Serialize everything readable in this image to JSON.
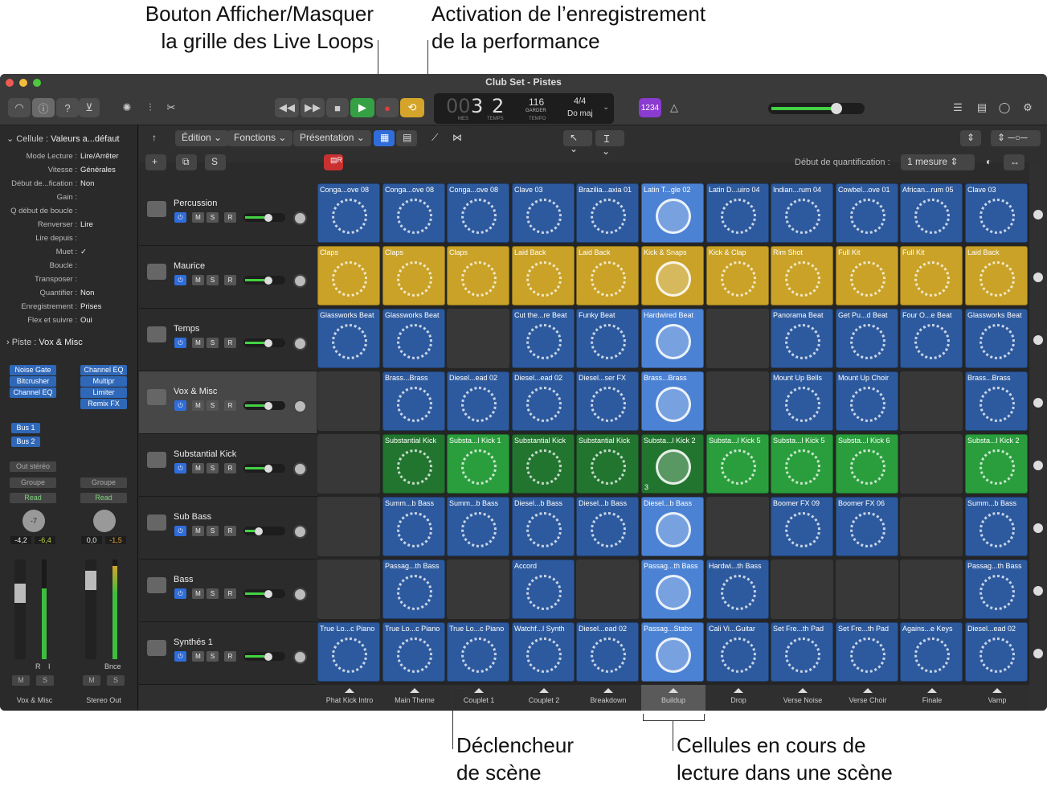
{
  "annotations": {
    "show_hide_grid_1": "Bouton Afficher/Masquer",
    "show_hide_grid_2": "la grille des Live Loops",
    "perf_record_1": "Activation de l’enregistrement",
    "perf_record_2": "de la performance",
    "scene_trigger_1": "Déclencheur",
    "scene_trigger_2": "de scène",
    "playing_cells_1": "Cellules en cours de",
    "playing_cells_2": "lecture dans une scène"
  },
  "window": {
    "title": "Club Set - Pistes"
  },
  "lcd": {
    "bars": "3",
    "beat_prefix": "00",
    "beats": "2",
    "tempo": "116",
    "tempo_mode": "GARDER",
    "signature": "4/4",
    "key": "Do maj",
    "label_bars": "MES",
    "label_beats": "TEMPS",
    "label_tempo": "TEMPO"
  },
  "count_in": "1234",
  "menus": {
    "edit": "Édition",
    "functions": "Fonctions",
    "view": "Présentation"
  },
  "quantize": {
    "label": "Début de quantification :",
    "value": "1 mesure"
  },
  "inspector": {
    "cell_header_key": "Cellule :",
    "cell_header_value": "Valeurs a...défaut",
    "rows": [
      {
        "k": "Mode Lecture :",
        "v": "Lire/Arrêter"
      },
      {
        "k": "Vitesse :",
        "v": "Générales"
      },
      {
        "k": "Début de...fication :",
        "v": "Non"
      },
      {
        "k": "Gain :",
        "v": ""
      },
      {
        "k": "Q début de boucle :",
        "v": ""
      },
      {
        "k": "Renverser :",
        "v": "Lire"
      },
      {
        "k": "Lire depuis :",
        "v": ""
      },
      {
        "k": "Muet :",
        "v": "✓"
      },
      {
        "k": "Boucle :",
        "v": ""
      },
      {
        "k": "Transposer :",
        "v": ""
      },
      {
        "k": "Quantifier :",
        "v": "Non"
      },
      {
        "k": "Enregistrement :",
        "v": "Prises"
      },
      {
        "k": "Flex et suivre :",
        "v": "Oui"
      }
    ],
    "track_header_key": "Piste :",
    "track_header_value": "Vox & Misc",
    "left_plugins": [
      "Noise Gate",
      "Bitcrusher",
      "Channel EQ"
    ],
    "right_plugins": [
      "Channel EQ",
      "Multipr",
      "Limiter",
      "Remix FX"
    ],
    "sends": [
      "Bus 1",
      "Bus 2"
    ],
    "output": "Out stéréo",
    "group": "Groupe",
    "automation": "Read",
    "left_pan_value": "-7",
    "left_vol": "-4,2",
    "left_peak": "-6,4",
    "right_vol": "0,0",
    "right_peak": "-1,5",
    "left_name": "Vox & Misc",
    "right_name": "Stereo Out",
    "bnce": "Bnce",
    "mute": "M",
    "solo": "S",
    "ri_r": "R",
    "ri_i": "I"
  },
  "tracks": [
    {
      "name": "Percussion",
      "selected": false
    },
    {
      "name": "Maurice",
      "selected": false
    },
    {
      "name": "Temps",
      "selected": false
    },
    {
      "name": "Vox & Misc",
      "selected": true
    },
    {
      "name": "Substantial Kick",
      "selected": false
    },
    {
      "name": "Sub Bass",
      "selected": false
    },
    {
      "name": "Bass",
      "selected": false
    },
    {
      "name": "Synthés 1",
      "selected": false
    }
  ],
  "track_buttons": {
    "m": "M",
    "s": "S",
    "r": "R"
  },
  "colors": {
    "blue": "#2d5a9e",
    "yellow": "#c9a227",
    "green": "#2a9e3c",
    "green_dark": "#22752f",
    "blue_playing": "#4b82d4"
  },
  "grid": [
    [
      [
        "blue",
        "Conga...ove 08"
      ],
      [
        "blue",
        "Conga...ove 08"
      ],
      [
        "blue",
        "Conga...ove 08"
      ],
      [
        "blue",
        "Clave 03"
      ],
      [
        "blue",
        "Brazilia...axia 01"
      ],
      [
        "blue",
        "Latin T...gle 02"
      ],
      [
        "blue",
        "Latin D...uiro 04"
      ],
      [
        "blue",
        "Indian...rum 04"
      ],
      [
        "blue",
        "Cowbel...ove 01"
      ],
      [
        "blue",
        "African...rum 05"
      ],
      [
        "blue",
        "Clave 03"
      ]
    ],
    [
      [
        "yellow",
        "Claps"
      ],
      [
        "yellow",
        "Claps"
      ],
      [
        "yellow",
        "Claps"
      ],
      [
        "yellow",
        "Laid Back"
      ],
      [
        "yellow",
        "Laid Back"
      ],
      [
        "yellow",
        "Kick & Snaps"
      ],
      [
        "yellow",
        "Kick & Clap"
      ],
      [
        "yellow",
        "Rim Shot"
      ],
      [
        "yellow",
        "Full Kit"
      ],
      [
        "yellow",
        "Full Kit"
      ],
      [
        "yellow",
        "Laid Back"
      ]
    ],
    [
      [
        "blue",
        "Glassworks Beat"
      ],
      [
        "blue",
        "Glassworks Beat"
      ],
      [
        "empty",
        ""
      ],
      [
        "blue",
        "Cut the...re Beat"
      ],
      [
        "blue",
        "Funky Beat"
      ],
      [
        "blue",
        "Hardwired Beat"
      ],
      [
        "empty",
        ""
      ],
      [
        "blue",
        "Panorama Beat"
      ],
      [
        "blue",
        "Get Pu...d Beat"
      ],
      [
        "blue",
        "Four O...e Beat"
      ],
      [
        "blue",
        "Glassworks Beat"
      ]
    ],
    [
      [
        "empty",
        ""
      ],
      [
        "blue",
        "Brass...Brass"
      ],
      [
        "blue",
        "Diesel...ead 02"
      ],
      [
        "blue",
        "Diesel...ead 02"
      ],
      [
        "blue",
        "Diesel...ser FX"
      ],
      [
        "blue",
        "Brass...Brass"
      ],
      [
        "empty",
        ""
      ],
      [
        "blue",
        "Mount Up Bells"
      ],
      [
        "blue",
        "Mount Up Choir"
      ],
      [
        "empty",
        ""
      ],
      [
        "blue",
        "Brass...Brass"
      ]
    ],
    [
      [
        "empty",
        ""
      ],
      [
        "green",
        "Substantial Kick"
      ],
      [
        "green",
        "Substa...l Kick 1"
      ],
      [
        "green",
        "Substantial Kick"
      ],
      [
        "green",
        "Substantial Kick"
      ],
      [
        "green",
        "Substa...l Kick 2"
      ],
      [
        "green",
        "Substa...l Kick 5"
      ],
      [
        "green",
        "Substa...l Kick 5"
      ],
      [
        "green",
        "Substa...l Kick 6"
      ],
      [
        "empty",
        ""
      ],
      [
        "green",
        "Substa...l Kick 2"
      ]
    ],
    [
      [
        "empty",
        ""
      ],
      [
        "blue",
        "Summ...b Bass"
      ],
      [
        "blue",
        "Summ...b Bass"
      ],
      [
        "blue",
        "Diesel...b Bass"
      ],
      [
        "blue",
        "Diesel...b Bass"
      ],
      [
        "blue",
        "Diesel...b Bass"
      ],
      [
        "empty",
        ""
      ],
      [
        "blue",
        "Boomer FX 09"
      ],
      [
        "blue",
        "Boomer FX 06"
      ],
      [
        "empty",
        ""
      ],
      [
        "blue",
        "Summ...b Bass"
      ]
    ],
    [
      [
        "empty",
        ""
      ],
      [
        "blue",
        "Passag...th Bass"
      ],
      [
        "empty",
        ""
      ],
      [
        "blue",
        "Accord"
      ],
      [
        "empty",
        ""
      ],
      [
        "blue",
        "Passag...th Bass"
      ],
      [
        "blue",
        "Hardwi...th Bass"
      ],
      [
        "empty",
        ""
      ],
      [
        "empty",
        ""
      ],
      [
        "empty",
        ""
      ],
      [
        "blue",
        "Passag...th Bass"
      ]
    ],
    [
      [
        "blue",
        "True Lo...c Piano"
      ],
      [
        "blue",
        "True Lo...c Piano"
      ],
      [
        "blue",
        "True Lo...c Piano"
      ],
      [
        "blue",
        "Watchf...l Synth"
      ],
      [
        "blue",
        "Diesel...ead 02"
      ],
      [
        "blue",
        "Passag...Stabs"
      ],
      [
        "blue",
        "Cali Vi...Guitar"
      ],
      [
        "blue",
        "Set Fre...th Pad"
      ],
      [
        "blue",
        "Set Fre...th Pad"
      ],
      [
        "blue",
        "Agains...e Keys"
      ],
      [
        "blue",
        "Diesel...ead 02"
      ]
    ]
  ],
  "cell_badge": "3",
  "scenes": [
    "Phat Kick Intro",
    "Main Theme",
    "Couplet 1",
    "Couplet 2",
    "Breakdown",
    "Buildup",
    "Drop",
    "Verse Noise",
    "Verse Choir",
    "Finale",
    "Vamp"
  ],
  "active_scene_index": 5
}
